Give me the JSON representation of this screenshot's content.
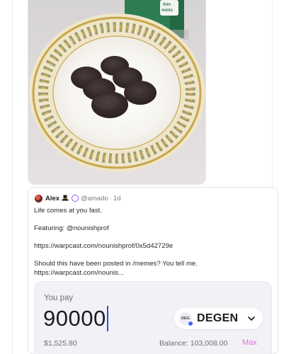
{
  "quote": {
    "author": "Alex",
    "handle": "@amado",
    "separator": "·",
    "age": "1d",
    "lines": [
      "Life comes at you fast.",
      "Featuring: @nounishprof",
      "https://warpcast.com/nounishprof/0x5d42729e",
      "Should this have been posted in /memes? You tell me.",
      "https://warpcast.com/nounis..."
    ]
  },
  "swap": {
    "pay_label": "You pay",
    "amount": "90000",
    "token_logo_text": "DEG",
    "token_symbol": "DEGEN",
    "usd_value": "$1,525.80",
    "balance": "Balance: 103,008.00",
    "max_label": "Max"
  },
  "colors": {
    "accent_max": "#e573e9",
    "caret": "#3d4bd6",
    "panel_bg": "#f2f2f6"
  },
  "icons": {
    "hat": "top-hat-icon",
    "verify": "verified-ring-icon",
    "chevron": "chevron-down-icon"
  }
}
